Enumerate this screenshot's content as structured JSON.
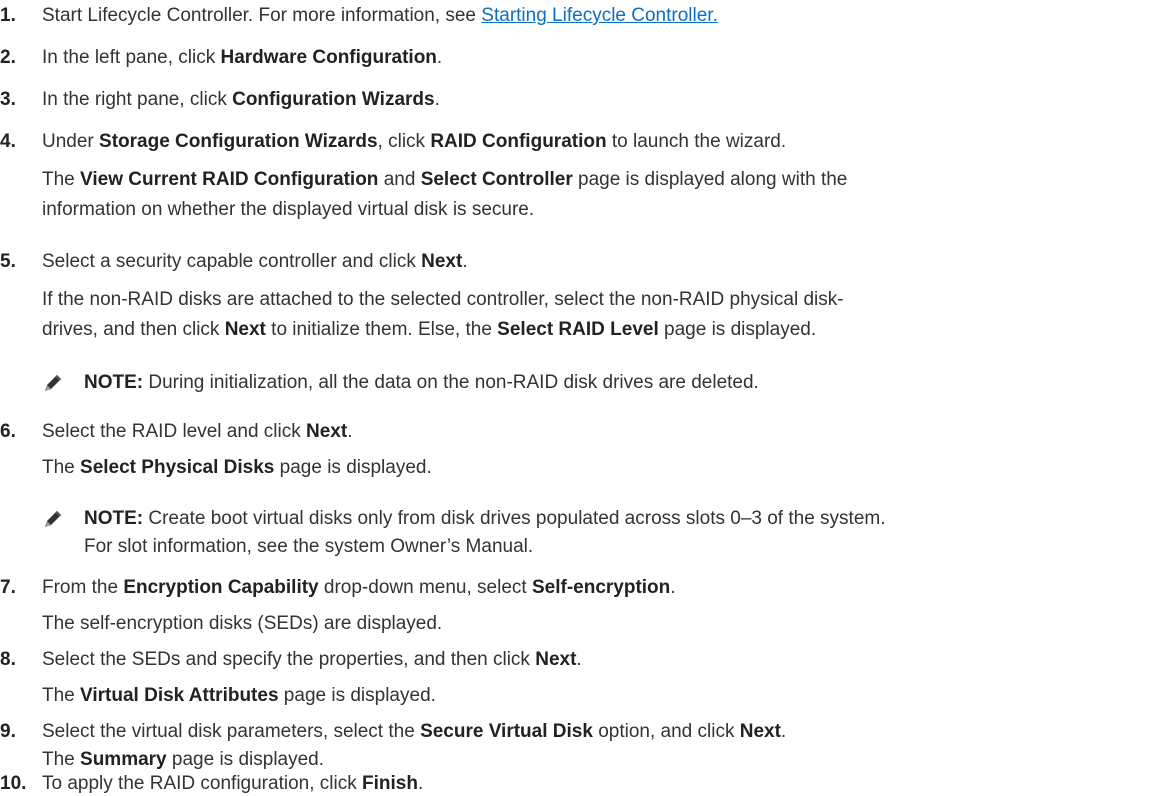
{
  "steps": [
    {
      "num": "1.",
      "parts": [
        {
          "t": "Start Lifecycle Controller. For more information, see "
        },
        {
          "t": "Starting Lifecycle Controller.",
          "link": true
        }
      ]
    },
    {
      "num": "2.",
      "parts": [
        {
          "t": "In the left pane, click "
        },
        {
          "t": "Hardware Configuration",
          "b": true
        },
        {
          "t": "."
        }
      ]
    },
    {
      "num": "3.",
      "parts": [
        {
          "t": "In the right pane, click "
        },
        {
          "t": "Configuration Wizards",
          "b": true
        },
        {
          "t": "."
        }
      ]
    },
    {
      "num": "4.",
      "parts": [
        {
          "t": "Under "
        },
        {
          "t": "Storage Configuration Wizards",
          "b": true
        },
        {
          "t": ", click "
        },
        {
          "t": "RAID Configuration",
          "b": true
        },
        {
          "t": " to launch the wizard."
        }
      ]
    },
    {
      "num": "5.",
      "parts": [
        {
          "t": "Select a security capable controller and click "
        },
        {
          "t": "Next",
          "b": true
        },
        {
          "t": "."
        }
      ]
    },
    {
      "num": "6.",
      "parts": [
        {
          "t": "Select the RAID level and click "
        },
        {
          "t": "Next",
          "b": true
        },
        {
          "t": "."
        }
      ]
    },
    {
      "num": "7.",
      "parts": [
        {
          "t": "From the "
        },
        {
          "t": "Encryption Capability",
          "b": true
        },
        {
          "t": " drop-down menu, select "
        },
        {
          "t": "Self-encryption",
          "b": true
        },
        {
          "t": "."
        }
      ]
    },
    {
      "num": "8.",
      "parts": [
        {
          "t": "Select the SEDs and specify the properties, and then click "
        },
        {
          "t": "Next",
          "b": true
        },
        {
          "t": "."
        }
      ]
    },
    {
      "num": "9.",
      "parts": [
        {
          "t": "Select the virtual disk parameters, select the "
        },
        {
          "t": "Secure Virtual Disk",
          "b": true
        },
        {
          "t": " option, and click "
        },
        {
          "t": "Next",
          "b": true
        },
        {
          "t": "."
        }
      ]
    },
    {
      "num": "10.",
      "parts": [
        {
          "t": "To apply the RAID configuration, click "
        },
        {
          "t": "Finish",
          "b": true
        },
        {
          "t": "."
        }
      ]
    }
  ],
  "results": {
    "r4_l1": [
      {
        "t": "The "
      },
      {
        "t": "View Current RAID Configuration",
        "b": true
      },
      {
        "t": " and "
      },
      {
        "t": "Select Controller",
        "b": true
      },
      {
        "t": " page is displayed along with the"
      }
    ],
    "r4_l2": [
      {
        "t": "information on whether the displayed virtual disk is secure."
      }
    ],
    "r5_l1": [
      {
        "t": "If the non-RAID disks are attached to the selected controller, select the non-RAID physical disk-"
      }
    ],
    "r5_l2": [
      {
        "t": "drives, and then click "
      },
      {
        "t": "Next",
        "b": true
      },
      {
        "t": " to initialize them. Else, the "
      },
      {
        "t": "Select RAID Level",
        "b": true
      },
      {
        "t": " page is displayed."
      }
    ],
    "r6": [
      {
        "t": "The "
      },
      {
        "t": "Select Physical Disks",
        "b": true
      },
      {
        "t": " page is displayed."
      }
    ],
    "r7": [
      {
        "t": "The self-encryption disks (SEDs) are displayed."
      }
    ],
    "r8": [
      {
        "t": "The "
      },
      {
        "t": "Virtual Disk Attributes",
        "b": true
      },
      {
        "t": " page is displayed."
      }
    ],
    "r9": [
      {
        "t": "The "
      },
      {
        "t": "Summary",
        "b": true
      },
      {
        "t": " page is displayed."
      }
    ]
  },
  "notes": {
    "n1": [
      {
        "t": "NOTE:",
        "b": true
      },
      {
        "t": " During initialization, all the data on the non-RAID disk drives are deleted."
      }
    ],
    "n2_l1": [
      {
        "t": "NOTE:",
        "b": true
      },
      {
        "t": " Create boot virtual disks only from disk drives populated across slots 0–3 of the system."
      }
    ],
    "n2_l2": [
      {
        "t": "For slot information, see the system Owner’s Manual."
      }
    ]
  },
  "icons": {
    "note": "pencil-note-icon"
  },
  "colors": {
    "link": "#0a6fc2",
    "text": "#333333"
  }
}
